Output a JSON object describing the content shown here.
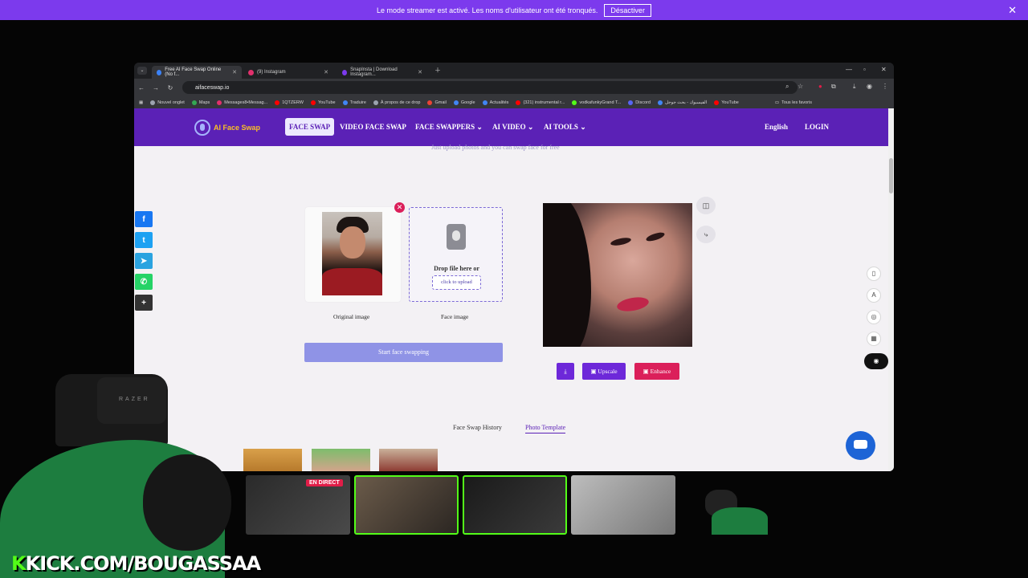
{
  "streamer_banner": {
    "message": "Le mode streamer est activé. Les noms d'utilisateur ont été tronqués.",
    "button_label": "Désactiver",
    "close": "✕"
  },
  "browser": {
    "tabs": [
      {
        "title": "Free AI Face Swap Online (No f...",
        "active": true,
        "color": "#3b82f6"
      },
      {
        "title": "(9) Instagram",
        "active": false,
        "color": "#e1306c"
      },
      {
        "title": "SnapInsta | Download Instagram...",
        "active": false,
        "color": "#7c3aed"
      }
    ],
    "url": "aifaceswap.io",
    "bookmarks": [
      {
        "label": "Nouvel onglet",
        "color": "#9ca3af"
      },
      {
        "label": "Maps",
        "color": "#34a853"
      },
      {
        "label": "Messages8•Messag...",
        "color": "#e1306c"
      },
      {
        "label": "1QTZERW",
        "color": "#ff0000"
      },
      {
        "label": "YouTube",
        "color": "#ff0000"
      },
      {
        "label": "Traduire",
        "color": "#4285f4"
      },
      {
        "label": "À propos de ce drop",
        "color": "#9ca3af"
      },
      {
        "label": "Gmail",
        "color": "#ea4335"
      },
      {
        "label": "Google",
        "color": "#4285f4"
      },
      {
        "label": "Actualités",
        "color": "#4285f4"
      },
      {
        "label": "(321) instrumental r...",
        "color": "#ff0000"
      },
      {
        "label": "vodkafunkyGrand T...",
        "color": "#53fc18"
      },
      {
        "label": "Discord",
        "color": "#5865f2"
      },
      {
        "label": "الفيسبوك - بحث جوجل",
        "color": "#4285f4"
      },
      {
        "label": "YouTube",
        "color": "#ff0000"
      }
    ],
    "all_bookmarks": "Tous les favoris"
  },
  "site": {
    "logo": "AI Face Swap",
    "nav": [
      {
        "label": "FACE SWAP",
        "active": true
      },
      {
        "label": "VIDEO FACE SWAP",
        "active": false
      },
      {
        "label": "FACE SWAPPERS",
        "active": false
      },
      {
        "label": "AI VIDEO",
        "active": false
      },
      {
        "label": "AI TOOLS",
        "active": false
      }
    ],
    "language": "English",
    "login": "LOGIN",
    "subtitle": "Just upload photos and you can swap face for free"
  },
  "swap": {
    "original_caption": "Original image",
    "face_caption": "Face image",
    "drop_text": "Drop file here or",
    "upload_button": "click to upload",
    "start_button": "Start face swapping"
  },
  "result_actions": {
    "download": "⤓",
    "upscale": "Upscale",
    "enhance": "Enhance"
  },
  "history_tabs": [
    "Face Swap History",
    "Photo Template"
  ],
  "stream": {
    "live_badge": "EN DIRECT",
    "chair_brand": "RAZER",
    "handle_k": "K",
    "handle": "KICK.COM/BOUGASSAA"
  },
  "colors": {
    "brand_purple": "#5b21b6",
    "streamer_bar": "#7c3aed",
    "start_button": "#8f93e6",
    "upscale": "#6d28d9",
    "enhance": "#db1f5a",
    "kick_green": "#53fc18"
  }
}
